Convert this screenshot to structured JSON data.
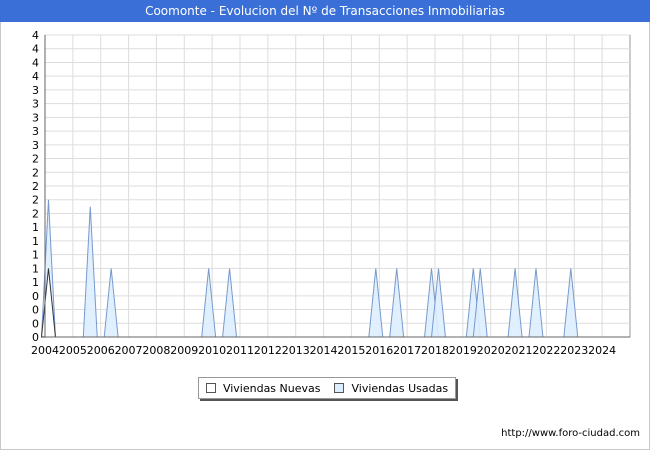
{
  "title": "Coomonte - Evolucion del Nº de Transacciones Inmobiliarias",
  "footer_url": "http://www.foro-ciudad.com",
  "chart_data": {
    "type": "area",
    "title": "Coomonte - Evolucion del Nº de Transacciones Inmobiliarias",
    "xlabel": "",
    "ylabel": "",
    "x_tick_labels": [
      "2004",
      "2005",
      "2006",
      "2007",
      "2008",
      "2009",
      "2010",
      "2011",
      "2012",
      "2013",
      "2014",
      "2015",
      "2016",
      "2017",
      "2018",
      "2019",
      "2020",
      "2021",
      "2022",
      "2023",
      "2024"
    ],
    "y_tick_labels": [
      "0",
      "0",
      "0",
      "0",
      "1",
      "1",
      "1",
      "1",
      "1",
      "2",
      "2",
      "2",
      "2",
      "2",
      "3",
      "3",
      "3",
      "3",
      "3",
      "4",
      "4",
      "4",
      "4"
    ],
    "ylim": [
      0,
      4.4
    ],
    "grid": true,
    "legend_position": "bottom-center",
    "x": [
      "2004T1",
      "2004T2",
      "2004T3",
      "2004T4",
      "2005T1",
      "2005T2",
      "2005T3",
      "2005T4",
      "2006T1",
      "2006T2",
      "2006T3",
      "2006T4",
      "2007T1",
      "2007T2",
      "2007T3",
      "2007T4",
      "2008T1",
      "2008T2",
      "2008T3",
      "2008T4",
      "2009T1",
      "2009T2",
      "2009T3",
      "2009T4",
      "2010T1",
      "2010T2",
      "2010T3",
      "2010T4",
      "2011T1",
      "2011T2",
      "2011T3",
      "2011T4",
      "2012T1",
      "2012T2",
      "2012T3",
      "2012T4",
      "2013T1",
      "2013T2",
      "2013T3",
      "2013T4",
      "2014T1",
      "2014T2",
      "2014T3",
      "2014T4",
      "2015T1",
      "2015T2",
      "2015T3",
      "2015T4",
      "2016T1",
      "2016T2",
      "2016T3",
      "2016T4",
      "2017T1",
      "2017T2",
      "2017T3",
      "2017T4",
      "2018T1",
      "2018T2",
      "2018T3",
      "2018T4",
      "2019T1",
      "2019T2",
      "2019T3",
      "2019T4",
      "2020T1",
      "2020T2",
      "2020T3",
      "2020T4",
      "2021T1",
      "2021T2",
      "2021T3",
      "2021T4",
      "2022T1",
      "2022T2",
      "2022T3",
      "2022T4",
      "2023T1",
      "2023T2",
      "2023T3",
      "2023T4",
      "2024T1",
      "2024T2",
      "2024T3",
      "2024T4"
    ],
    "series": [
      {
        "name": "Viviendas Nuevas",
        "color": "#ffffff",
        "stroke": "#333333",
        "values": [
          1,
          0,
          0,
          0,
          0,
          0,
          0,
          0,
          0,
          0,
          0,
          0,
          0,
          0,
          0,
          0,
          0,
          0,
          0,
          0,
          0,
          0,
          0,
          0,
          0,
          0,
          0,
          0,
          0,
          0,
          0,
          0,
          0,
          0,
          0,
          0,
          0,
          0,
          0,
          0,
          0,
          0,
          0,
          0,
          0,
          0,
          0,
          0,
          0,
          0,
          0,
          0,
          0,
          0,
          0,
          0,
          0,
          0,
          0,
          0,
          0,
          0,
          0,
          0,
          0,
          0,
          0,
          0,
          0,
          0,
          0,
          0,
          0,
          0,
          0,
          0,
          0,
          0,
          0,
          0,
          0,
          0,
          0,
          0
        ]
      },
      {
        "name": "Viviendas Usadas",
        "color": "#ddeeff",
        "stroke": "#7799cc",
        "values": [
          2,
          0,
          0,
          0,
          0,
          0,
          1.9,
          0,
          0,
          1,
          0,
          0,
          0,
          0,
          0,
          0,
          0,
          0,
          0,
          0,
          0,
          0,
          0,
          1,
          0,
          0,
          1,
          0,
          0,
          0,
          0,
          0,
          0,
          0,
          0,
          0,
          0,
          0,
          0,
          0,
          0,
          0,
          0,
          0,
          0,
          0,
          0,
          1,
          0,
          0,
          1,
          0,
          0,
          0,
          0,
          1,
          1,
          0,
          0,
          0,
          0,
          1,
          1,
          0,
          0,
          0,
          0,
          1,
          0,
          0,
          1,
          0,
          0,
          0,
          0,
          1,
          0,
          0,
          0,
          0,
          0,
          0,
          0,
          0
        ]
      }
    ]
  }
}
